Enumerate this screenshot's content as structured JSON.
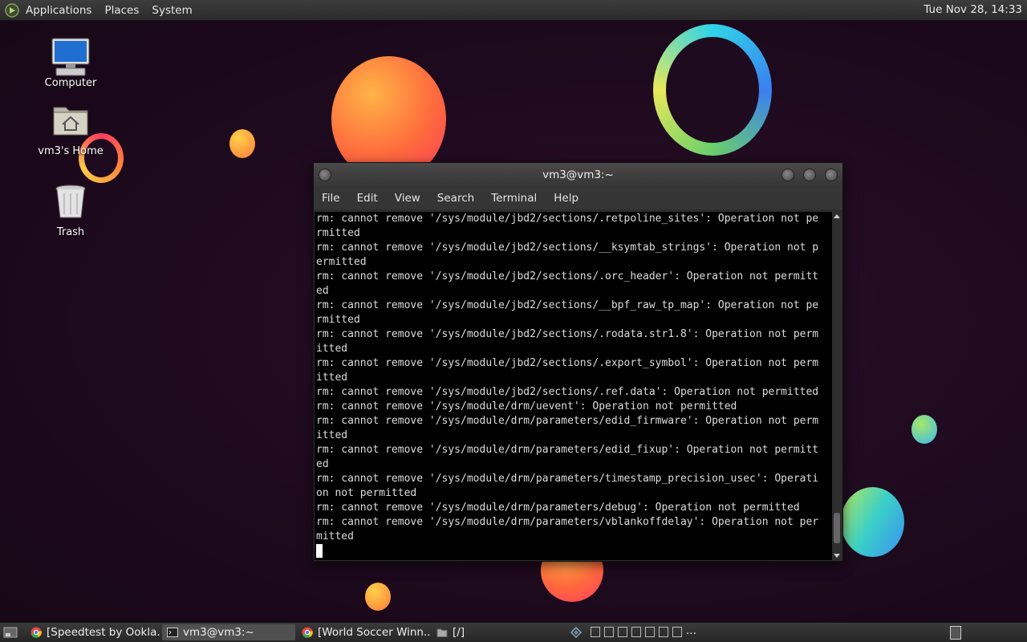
{
  "top_panel": {
    "menus": [
      "Applications",
      "Places",
      "System"
    ],
    "clock": "Tue Nov 28, 14:33"
  },
  "desktop": {
    "icons": [
      {
        "label": "Computer",
        "icon": "computer-icon"
      },
      {
        "label": "vm3's Home",
        "icon": "home-folder-icon"
      },
      {
        "label": "Trash",
        "icon": "trash-icon"
      }
    ]
  },
  "terminal": {
    "title": "vm3@vm3:~",
    "menu": [
      "File",
      "Edit",
      "View",
      "Search",
      "Terminal",
      "Help"
    ],
    "lines": [
      "rm: cannot remove '/sys/module/jbd2/sections/.retpoline_sites': Operation not pe",
      "rmitted",
      "rm: cannot remove '/sys/module/jbd2/sections/__ksymtab_strings': Operation not p",
      "ermitted",
      "rm: cannot remove '/sys/module/jbd2/sections/.orc_header': Operation not permitt",
      "ed",
      "rm: cannot remove '/sys/module/jbd2/sections/__bpf_raw_tp_map': Operation not pe",
      "rmitted",
      "rm: cannot remove '/sys/module/jbd2/sections/.rodata.str1.8': Operation not perm",
      "itted",
      "rm: cannot remove '/sys/module/jbd2/sections/.export_symbol': Operation not perm",
      "itted",
      "rm: cannot remove '/sys/module/jbd2/sections/.ref.data': Operation not permitted",
      "rm: cannot remove '/sys/module/drm/uevent': Operation not permitted",
      "rm: cannot remove '/sys/module/drm/parameters/edid_firmware': Operation not perm",
      "itted",
      "rm: cannot remove '/sys/module/drm/parameters/edid_fixup': Operation not permitt",
      "ed",
      "rm: cannot remove '/sys/module/drm/parameters/timestamp_precision_usec': Operati",
      "on not permitted",
      "rm: cannot remove '/sys/module/drm/parameters/debug': Operation not permitted",
      "rm: cannot remove '/sys/module/drm/parameters/vblankoffdelay': Operation not per",
      "mitted"
    ]
  },
  "taskbar": {
    "tasks": [
      {
        "label": "[Speedtest by Ookla...",
        "icon": "chrome-icon"
      },
      {
        "label": "vm3@vm3:~",
        "icon": "terminal-icon"
      },
      {
        "label": "[World Soccer Winn...",
        "icon": "chrome-icon"
      },
      {
        "label": "[/]",
        "icon": "folder-icon"
      }
    ],
    "workspace_overflow": "..."
  }
}
